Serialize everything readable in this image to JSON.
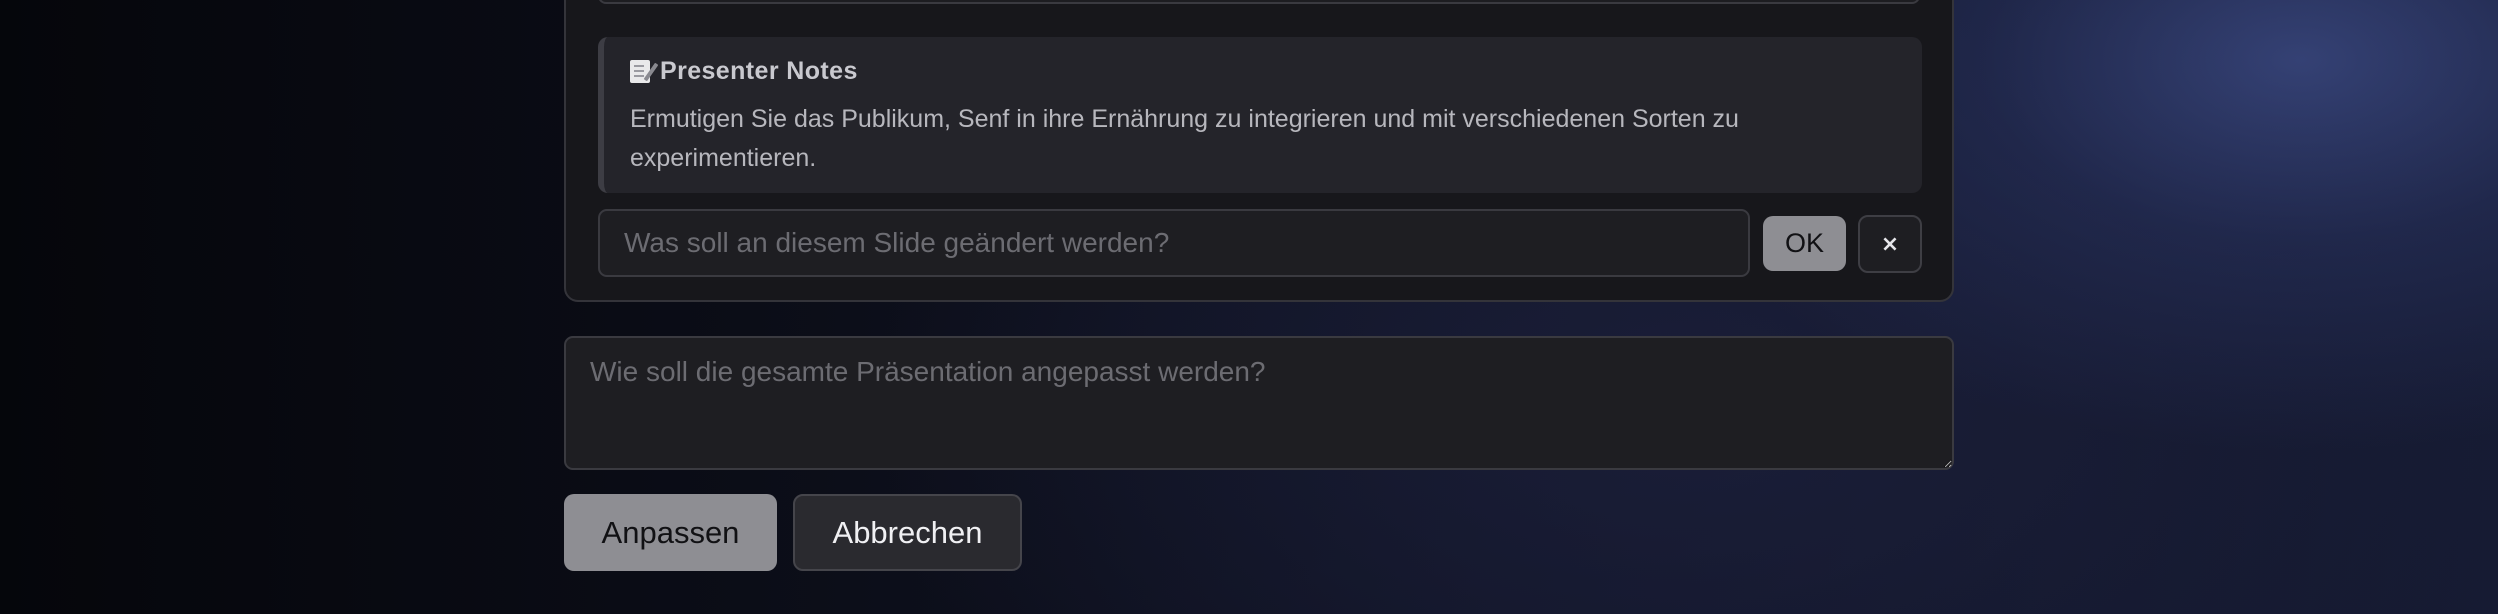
{
  "slide_card": {
    "presenter_notes": {
      "icon": "memo-icon",
      "title": "Presenter Notes",
      "text": "Ermutigen Sie das Publikum, Senf in ihre Ernährung zu integrieren und mit verschiedenen Sorten zu experimentieren."
    },
    "slide_edit": {
      "placeholder": "Was soll an diesem Slide geändert werden?",
      "value": "",
      "ok_label": "OK",
      "close_label": "×",
      "close_icon": "close-icon"
    }
  },
  "presentation_edit": {
    "placeholder": "Wie soll die gesamte Präsentation angepasst werden?",
    "value": ""
  },
  "actions": {
    "apply_label": "Anpassen",
    "cancel_label": "Abbrechen"
  },
  "colors": {
    "card_background": "#17171b",
    "primary_button": "#8e8e93",
    "secondary_button": "#2a2a2f",
    "placeholder_text": "#6c6c72"
  }
}
